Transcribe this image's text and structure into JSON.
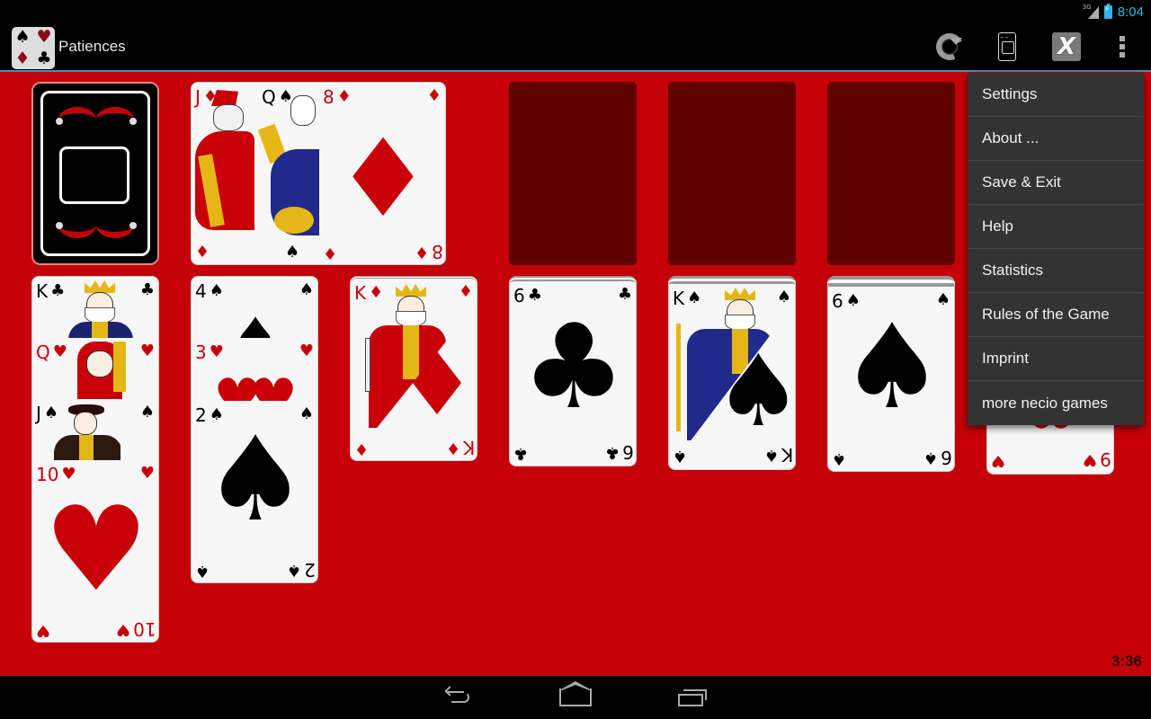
{
  "status_bar": {
    "network_label": "3G",
    "clock": "8:04",
    "accent_color": "#33b5e5"
  },
  "action_bar": {
    "app_title": "Patiences",
    "app_icon_suits": [
      "♠",
      "♥",
      "♦",
      "♣"
    ],
    "buttons": [
      {
        "name": "restart",
        "icon": "refresh-icon"
      },
      {
        "name": "layout",
        "icon": "phone-layout-icon"
      },
      {
        "name": "close-game",
        "icon": "x-icon",
        "glyph": "X"
      },
      {
        "name": "overflow",
        "icon": "more-vert-icon"
      }
    ]
  },
  "overflow_menu": {
    "items": [
      {
        "label": "Settings"
      },
      {
        "label": "About ..."
      },
      {
        "label": "Save & Exit"
      },
      {
        "label": "Help"
      },
      {
        "label": "Statistics"
      },
      {
        "label": "Rules of the Game"
      },
      {
        "label": "Imprint"
      },
      {
        "label": "more necio games"
      }
    ]
  },
  "game": {
    "felt_color": "#c40008",
    "empty_slot_color": "#600000",
    "timer": "3:36",
    "stock": {
      "face_down": true
    },
    "waste": [
      {
        "rank": "J",
        "suit": "♦",
        "color": "red"
      },
      {
        "rank": "Q",
        "suit": "♠",
        "color": "black"
      },
      {
        "rank": "8",
        "suit": "♦",
        "color": "red"
      }
    ],
    "foundations": [
      {
        "empty": true
      },
      {
        "empty": true
      },
      {
        "empty": true
      }
    ],
    "tableau": [
      {
        "cards": [
          {
            "rank": "K",
            "suit": "♣",
            "color": "black"
          },
          {
            "rank": "Q",
            "suit": "♥",
            "color": "red"
          },
          {
            "rank": "J",
            "suit": "♠",
            "color": "black"
          },
          {
            "rank": "10",
            "suit": "♥",
            "color": "red"
          }
        ]
      },
      {
        "cards": [
          {
            "rank": "4",
            "suit": "♠",
            "color": "black"
          },
          {
            "rank": "3",
            "suit": "♥",
            "color": "red"
          },
          {
            "rank": "2",
            "suit": "♠",
            "color": "black"
          }
        ]
      },
      {
        "cards": [
          {
            "rank": "K",
            "suit": "♦",
            "color": "red"
          }
        ]
      },
      {
        "cards": [
          {
            "rank": "6",
            "suit": "♣",
            "color": "black"
          }
        ]
      },
      {
        "cards": [
          {
            "rank": "K",
            "suit": "♠",
            "color": "black"
          }
        ]
      },
      {
        "cards": [
          {
            "rank": "6",
            "suit": "♠",
            "color": "black"
          }
        ]
      },
      {
        "cards": [
          {
            "rank": "9",
            "suit": "♥",
            "color": "red"
          }
        ]
      }
    ]
  },
  "nav_bar": {
    "buttons": [
      {
        "name": "back",
        "icon": "back-icon"
      },
      {
        "name": "home",
        "icon": "home-icon"
      },
      {
        "name": "recents",
        "icon": "recents-icon"
      }
    ]
  }
}
